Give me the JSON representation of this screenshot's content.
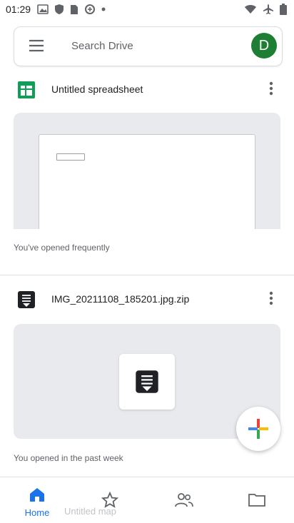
{
  "status_bar": {
    "time": "01:29",
    "left_icons": [
      "photos-icon",
      "shield-icon",
      "sim-icon",
      "data-saver-icon",
      "dot-icon"
    ],
    "right_icons": [
      "wifi-icon",
      "airplane-icon",
      "battery-icon"
    ]
  },
  "search": {
    "placeholder": "Search Drive",
    "avatar_letter": "D",
    "avatar_color": "#1e7e34"
  },
  "files": [
    {
      "name": "Untitled spreadsheet",
      "icon": "sheets-icon",
      "icon_color": "#0f9d58",
      "reason": "You've opened frequently"
    },
    {
      "name": "IMG_20211108_185201.jpg.zip",
      "icon": "zip-icon",
      "icon_color": "#202124",
      "reason": "You opened in the past week"
    }
  ],
  "fab": {
    "icon": "plus-icon",
    "label": ""
  },
  "bottom_nav": {
    "items": [
      {
        "label": "Home",
        "icon": "home-icon",
        "active": true
      },
      {
        "label": "",
        "icon": "star-icon",
        "active": false
      },
      {
        "label": "",
        "icon": "shared-icon",
        "active": false
      },
      {
        "label": "",
        "icon": "folder-icon",
        "active": false
      }
    ],
    "ghost_text": "Untitled map",
    "accent": "#1a73e8"
  }
}
